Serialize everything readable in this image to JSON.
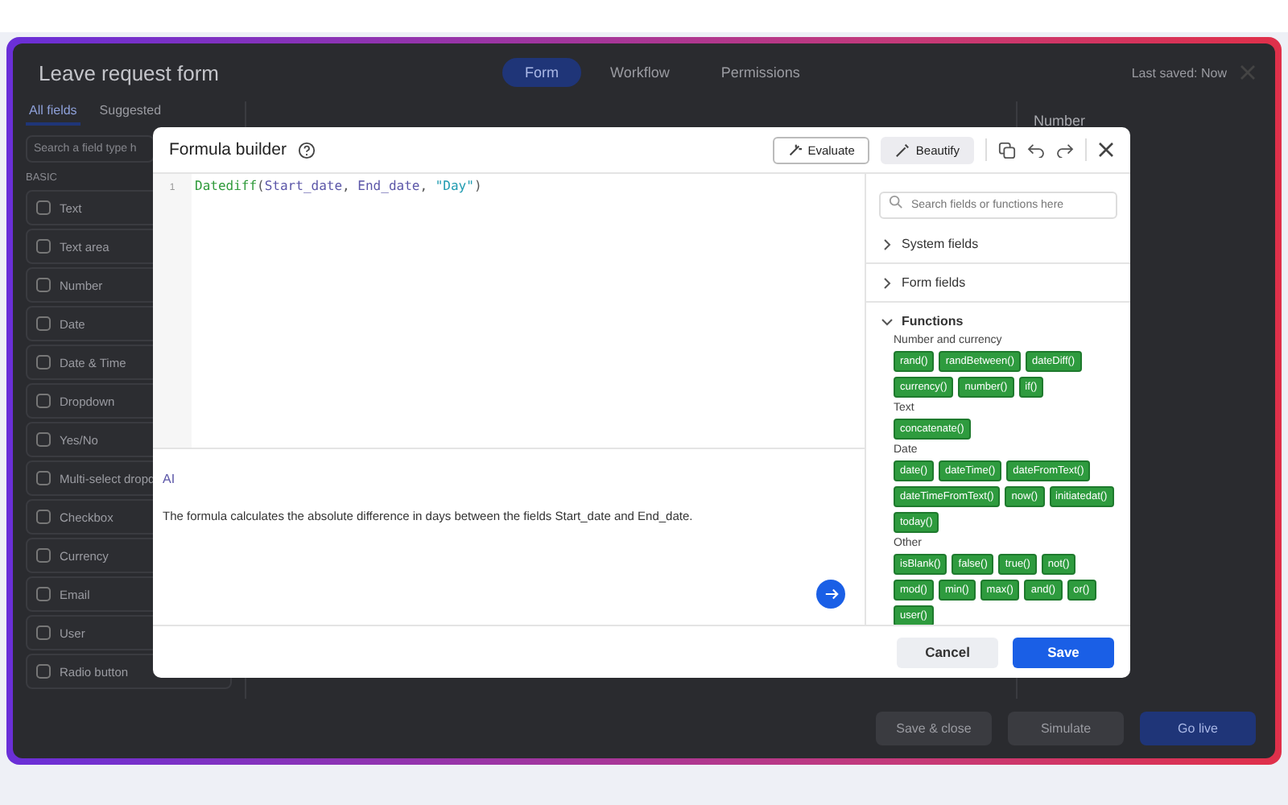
{
  "app": {
    "title": "Leave request form",
    "tabs": [
      {
        "label": "Form",
        "selected": true
      },
      {
        "label": "Workflow",
        "selected": false
      },
      {
        "label": "Permissions",
        "selected": false
      }
    ],
    "last_saved": "Last saved: Now"
  },
  "sidebar": {
    "tabs": [
      {
        "label": "All fields",
        "selected": true
      },
      {
        "label": "Suggested",
        "selected": false
      }
    ],
    "search_placeholder": "Search a field type h",
    "section": "BASIC",
    "items": [
      "Text",
      "Text area",
      "Number",
      "Date",
      "Date & Time",
      "Dropdown",
      "Yes/No",
      "Multi-select dropd",
      "Checkbox",
      "Currency",
      "Email",
      "User",
      "Radio button"
    ]
  },
  "properties": {
    "title": "Number"
  },
  "footer_buttons": [
    "Save & close",
    "Simulate",
    "Go live"
  ],
  "formula_builder": {
    "title": "Formula builder",
    "actions": [
      "Evaluate",
      "Beautify"
    ],
    "code": {
      "line_number": "1",
      "tokens": [
        {
          "kind": "function",
          "text": "Datediff"
        },
        {
          "kind": "punct",
          "text": "("
        },
        {
          "kind": "field",
          "text": "Start_date"
        },
        {
          "kind": "punct",
          "text": ", "
        },
        {
          "kind": "field",
          "text": "End_date"
        },
        {
          "kind": "punct",
          "text": ", "
        },
        {
          "kind": "string",
          "text": "\"Day\""
        },
        {
          "kind": "punct",
          "text": ")"
        }
      ]
    },
    "ai_label": "AI",
    "ai_explanation": "The formula calculates the absolute difference in days between the fields Start_date and End_date.",
    "search_placeholder": "Search fields or functions here",
    "sections": [
      {
        "label": "System fields",
        "expanded": false
      },
      {
        "label": "Form fields",
        "expanded": false
      },
      {
        "label": "Functions",
        "expanded": true
      }
    ],
    "function_groups": [
      {
        "name": "Number and currency",
        "functions": [
          "rand()",
          "randBetween()",
          "dateDiff()",
          "currency()",
          "number()",
          "if()"
        ]
      },
      {
        "name": "Text",
        "functions": [
          "concatenate()"
        ]
      },
      {
        "name": "Date",
        "functions": [
          "date()",
          "dateTime()",
          "dateFromText()",
          "dateTimeFromText()",
          "now()",
          "initiatedat()",
          "today()"
        ]
      },
      {
        "name": "Other",
        "functions": [
          "isBlank()",
          "false()",
          "true()",
          "not()",
          "mod()",
          "min()",
          "max()",
          "and()",
          "or()",
          "user()"
        ]
      }
    ],
    "buttons": [
      "Cancel",
      "Save"
    ]
  }
}
